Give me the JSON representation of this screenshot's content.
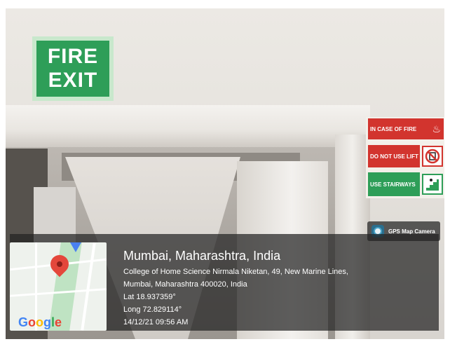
{
  "signs": {
    "fire_exit_line1": "FIRE",
    "fire_exit_line2": "EXIT",
    "in_case_of_fire": "IN CASE OF FIRE",
    "do_not_use_lift": "DO NOT USE LIFT",
    "use_stairways": "USE STAIRWAYS"
  },
  "camera_app": {
    "label": "GPS Map Camera"
  },
  "location": {
    "title": "Mumbai, Maharashtra, India",
    "address_line1": "College of Home Science Nirmala Niketan, 49, New Marine Lines,",
    "address_line2": "Mumbai, Maharashtra 400020, India",
    "lat": "Lat 18.937359°",
    "long": "Long 72.829114°",
    "datetime": "14/12/21 09:56 AM"
  },
  "map": {
    "google_g": "G",
    "google_o1": "o",
    "google_o2": "o",
    "google_g2": "g",
    "google_l": "l",
    "google_e": "e"
  },
  "colors": {
    "sign_green": "#2e9e58",
    "sign_red": "#d2342e",
    "pin_red": "#e4473b"
  }
}
